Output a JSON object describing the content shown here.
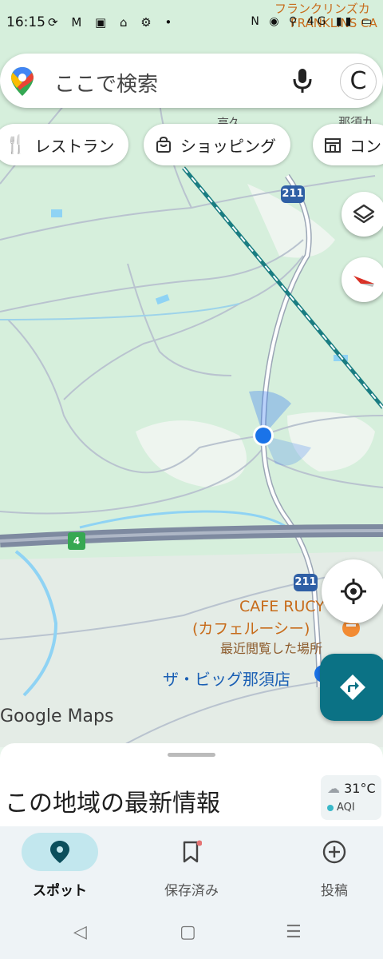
{
  "status_bar": {
    "time": "16:15",
    "left_icons": [
      "sync-icon",
      "gmail-icon",
      "app-icon",
      "home-icon",
      "settings-icon",
      "dot-icon"
    ],
    "left_text": "⟳ M ▣ ⌂ ⚙ •",
    "right_text": "N ◉ ⚲ 4G ▮▮ ▭"
  },
  "search": {
    "placeholder": "ここで検索",
    "avatar_letter": "C"
  },
  "chips": [
    {
      "label": "レストラン",
      "icon": "restaurant-icon"
    },
    {
      "label": "ショッピング",
      "icon": "shopping-bag-icon"
    },
    {
      "label": "コン",
      "icon": "store-icon"
    }
  ],
  "map": {
    "top_label_line1": "フランクリンズカ",
    "top_label_line2": "FRANKLINS CA",
    "town_label_1": "高久",
    "town_label_2": "那須九",
    "route_shield_top": "211",
    "route_shield_bottom": "211",
    "expressway_number": "4",
    "cafe_name": "CAFE RUCY",
    "cafe_subname": "(カフェルーシー)",
    "cafe_note": "最近閲覧した場所",
    "store_name": "ザ・ビッグ那須店",
    "watermark": "Google Maps",
    "colors": {
      "land": "#d6efdc",
      "road": "#ffffff",
      "highway": "#8a95a8",
      "rail": "#1a7d82",
      "river": "#8fd3f4"
    }
  },
  "sheet": {
    "title": "この地域の最新情報",
    "temperature": "31°C",
    "aqi_label": "AQI"
  },
  "bottom_nav": [
    {
      "label": "スポット",
      "icon": "explore-pin-icon",
      "active": true
    },
    {
      "label": "保存済み",
      "icon": "bookmark-icon",
      "active": false
    },
    {
      "label": "投稿",
      "icon": "add-circle-icon",
      "active": false
    }
  ],
  "system_nav": {
    "back": "◁",
    "home": "▢",
    "recents": "☰"
  }
}
